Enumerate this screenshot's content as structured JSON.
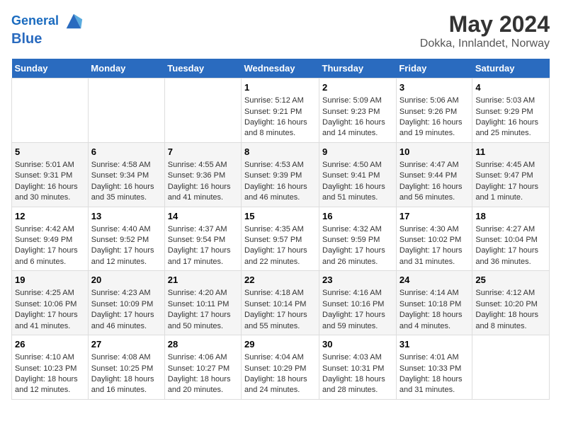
{
  "header": {
    "logo_line1": "General",
    "logo_line2": "Blue",
    "main_title": "May 2024",
    "subtitle": "Dokka, Innlandet, Norway"
  },
  "days_header": [
    "Sunday",
    "Monday",
    "Tuesday",
    "Wednesday",
    "Thursday",
    "Friday",
    "Saturday"
  ],
  "weeks": [
    [
      {
        "day": "",
        "sunrise": "",
        "sunset": "",
        "daylight": ""
      },
      {
        "day": "",
        "sunrise": "",
        "sunset": "",
        "daylight": ""
      },
      {
        "day": "",
        "sunrise": "",
        "sunset": "",
        "daylight": ""
      },
      {
        "day": "1",
        "sunrise": "Sunrise: 5:12 AM",
        "sunset": "Sunset: 9:21 PM",
        "daylight": "Daylight: 16 hours and 8 minutes."
      },
      {
        "day": "2",
        "sunrise": "Sunrise: 5:09 AM",
        "sunset": "Sunset: 9:23 PM",
        "daylight": "Daylight: 16 hours and 14 minutes."
      },
      {
        "day": "3",
        "sunrise": "Sunrise: 5:06 AM",
        "sunset": "Sunset: 9:26 PM",
        "daylight": "Daylight: 16 hours and 19 minutes."
      },
      {
        "day": "4",
        "sunrise": "Sunrise: 5:03 AM",
        "sunset": "Sunset: 9:29 PM",
        "daylight": "Daylight: 16 hours and 25 minutes."
      }
    ],
    [
      {
        "day": "5",
        "sunrise": "Sunrise: 5:01 AM",
        "sunset": "Sunset: 9:31 PM",
        "daylight": "Daylight: 16 hours and 30 minutes."
      },
      {
        "day": "6",
        "sunrise": "Sunrise: 4:58 AM",
        "sunset": "Sunset: 9:34 PM",
        "daylight": "Daylight: 16 hours and 35 minutes."
      },
      {
        "day": "7",
        "sunrise": "Sunrise: 4:55 AM",
        "sunset": "Sunset: 9:36 PM",
        "daylight": "Daylight: 16 hours and 41 minutes."
      },
      {
        "day": "8",
        "sunrise": "Sunrise: 4:53 AM",
        "sunset": "Sunset: 9:39 PM",
        "daylight": "Daylight: 16 hours and 46 minutes."
      },
      {
        "day": "9",
        "sunrise": "Sunrise: 4:50 AM",
        "sunset": "Sunset: 9:41 PM",
        "daylight": "Daylight: 16 hours and 51 minutes."
      },
      {
        "day": "10",
        "sunrise": "Sunrise: 4:47 AM",
        "sunset": "Sunset: 9:44 PM",
        "daylight": "Daylight: 16 hours and 56 minutes."
      },
      {
        "day": "11",
        "sunrise": "Sunrise: 4:45 AM",
        "sunset": "Sunset: 9:47 PM",
        "daylight": "Daylight: 17 hours and 1 minute."
      }
    ],
    [
      {
        "day": "12",
        "sunrise": "Sunrise: 4:42 AM",
        "sunset": "Sunset: 9:49 PM",
        "daylight": "Daylight: 17 hours and 6 minutes."
      },
      {
        "day": "13",
        "sunrise": "Sunrise: 4:40 AM",
        "sunset": "Sunset: 9:52 PM",
        "daylight": "Daylight: 17 hours and 12 minutes."
      },
      {
        "day": "14",
        "sunrise": "Sunrise: 4:37 AM",
        "sunset": "Sunset: 9:54 PM",
        "daylight": "Daylight: 17 hours and 17 minutes."
      },
      {
        "day": "15",
        "sunrise": "Sunrise: 4:35 AM",
        "sunset": "Sunset: 9:57 PM",
        "daylight": "Daylight: 17 hours and 22 minutes."
      },
      {
        "day": "16",
        "sunrise": "Sunrise: 4:32 AM",
        "sunset": "Sunset: 9:59 PM",
        "daylight": "Daylight: 17 hours and 26 minutes."
      },
      {
        "day": "17",
        "sunrise": "Sunrise: 4:30 AM",
        "sunset": "Sunset: 10:02 PM",
        "daylight": "Daylight: 17 hours and 31 minutes."
      },
      {
        "day": "18",
        "sunrise": "Sunrise: 4:27 AM",
        "sunset": "Sunset: 10:04 PM",
        "daylight": "Daylight: 17 hours and 36 minutes."
      }
    ],
    [
      {
        "day": "19",
        "sunrise": "Sunrise: 4:25 AM",
        "sunset": "Sunset: 10:06 PM",
        "daylight": "Daylight: 17 hours and 41 minutes."
      },
      {
        "day": "20",
        "sunrise": "Sunrise: 4:23 AM",
        "sunset": "Sunset: 10:09 PM",
        "daylight": "Daylight: 17 hours and 46 minutes."
      },
      {
        "day": "21",
        "sunrise": "Sunrise: 4:20 AM",
        "sunset": "Sunset: 10:11 PM",
        "daylight": "Daylight: 17 hours and 50 minutes."
      },
      {
        "day": "22",
        "sunrise": "Sunrise: 4:18 AM",
        "sunset": "Sunset: 10:14 PM",
        "daylight": "Daylight: 17 hours and 55 minutes."
      },
      {
        "day": "23",
        "sunrise": "Sunrise: 4:16 AM",
        "sunset": "Sunset: 10:16 PM",
        "daylight": "Daylight: 17 hours and 59 minutes."
      },
      {
        "day": "24",
        "sunrise": "Sunrise: 4:14 AM",
        "sunset": "Sunset: 10:18 PM",
        "daylight": "Daylight: 18 hours and 4 minutes."
      },
      {
        "day": "25",
        "sunrise": "Sunrise: 4:12 AM",
        "sunset": "Sunset: 10:20 PM",
        "daylight": "Daylight: 18 hours and 8 minutes."
      }
    ],
    [
      {
        "day": "26",
        "sunrise": "Sunrise: 4:10 AM",
        "sunset": "Sunset: 10:23 PM",
        "daylight": "Daylight: 18 hours and 12 minutes."
      },
      {
        "day": "27",
        "sunrise": "Sunrise: 4:08 AM",
        "sunset": "Sunset: 10:25 PM",
        "daylight": "Daylight: 18 hours and 16 minutes."
      },
      {
        "day": "28",
        "sunrise": "Sunrise: 4:06 AM",
        "sunset": "Sunset: 10:27 PM",
        "daylight": "Daylight: 18 hours and 20 minutes."
      },
      {
        "day": "29",
        "sunrise": "Sunrise: 4:04 AM",
        "sunset": "Sunset: 10:29 PM",
        "daylight": "Daylight: 18 hours and 24 minutes."
      },
      {
        "day": "30",
        "sunrise": "Sunrise: 4:03 AM",
        "sunset": "Sunset: 10:31 PM",
        "daylight": "Daylight: 18 hours and 28 minutes."
      },
      {
        "day": "31",
        "sunrise": "Sunrise: 4:01 AM",
        "sunset": "Sunset: 10:33 PM",
        "daylight": "Daylight: 18 hours and 31 minutes."
      },
      {
        "day": "",
        "sunrise": "",
        "sunset": "",
        "daylight": ""
      }
    ]
  ]
}
